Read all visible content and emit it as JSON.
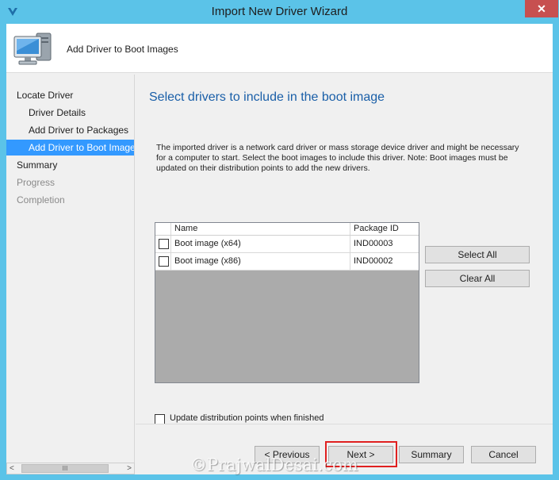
{
  "window": {
    "title": "Import New Driver Wizard",
    "close_glyph": "✕"
  },
  "header": {
    "title": "Add Driver to Boot Images",
    "icon": "computer-icon"
  },
  "nav": {
    "items": [
      {
        "label": "Locate Driver"
      },
      {
        "label": "Driver Details"
      },
      {
        "label": "Add Driver to Packages"
      },
      {
        "label": "Add Driver to Boot Images"
      },
      {
        "label": "Summary"
      },
      {
        "label": "Progress"
      },
      {
        "label": "Completion"
      }
    ],
    "scroll_left": "<",
    "scroll_right": ">",
    "scroll_thumb": "III"
  },
  "main": {
    "title": "Select drivers to include in the boot image",
    "description": "The imported driver is a network card driver or mass storage device driver and might be necessary for a computer to start. Select the boot images to include this driver.  Note: Boot images must be updated on their distribution points to add the new drivers.",
    "grid": {
      "columns": [
        "Name",
        "Package ID"
      ],
      "rows": [
        {
          "name": "Boot image (x64)",
          "package_id": "IND00003",
          "checked": false
        },
        {
          "name": "Boot image (x86)",
          "package_id": "IND00002",
          "checked": false
        }
      ]
    },
    "select_all_label": "Select All",
    "clear_all_label": "Clear All",
    "update_dp_label": "Update distribution points when finished",
    "update_dp_checked": false
  },
  "footer": {
    "previous_label": "< Previous",
    "next_label": "Next >",
    "summary_label": "Summary",
    "cancel_label": "Cancel"
  },
  "watermark": "©PrajwalDesai.com",
  "colors": {
    "titlebar": "#5bc3e8",
    "selection": "#3399ff",
    "heading": "#1a5fa8",
    "close_button": "#c75050",
    "highlight_box": "#e02020"
  }
}
